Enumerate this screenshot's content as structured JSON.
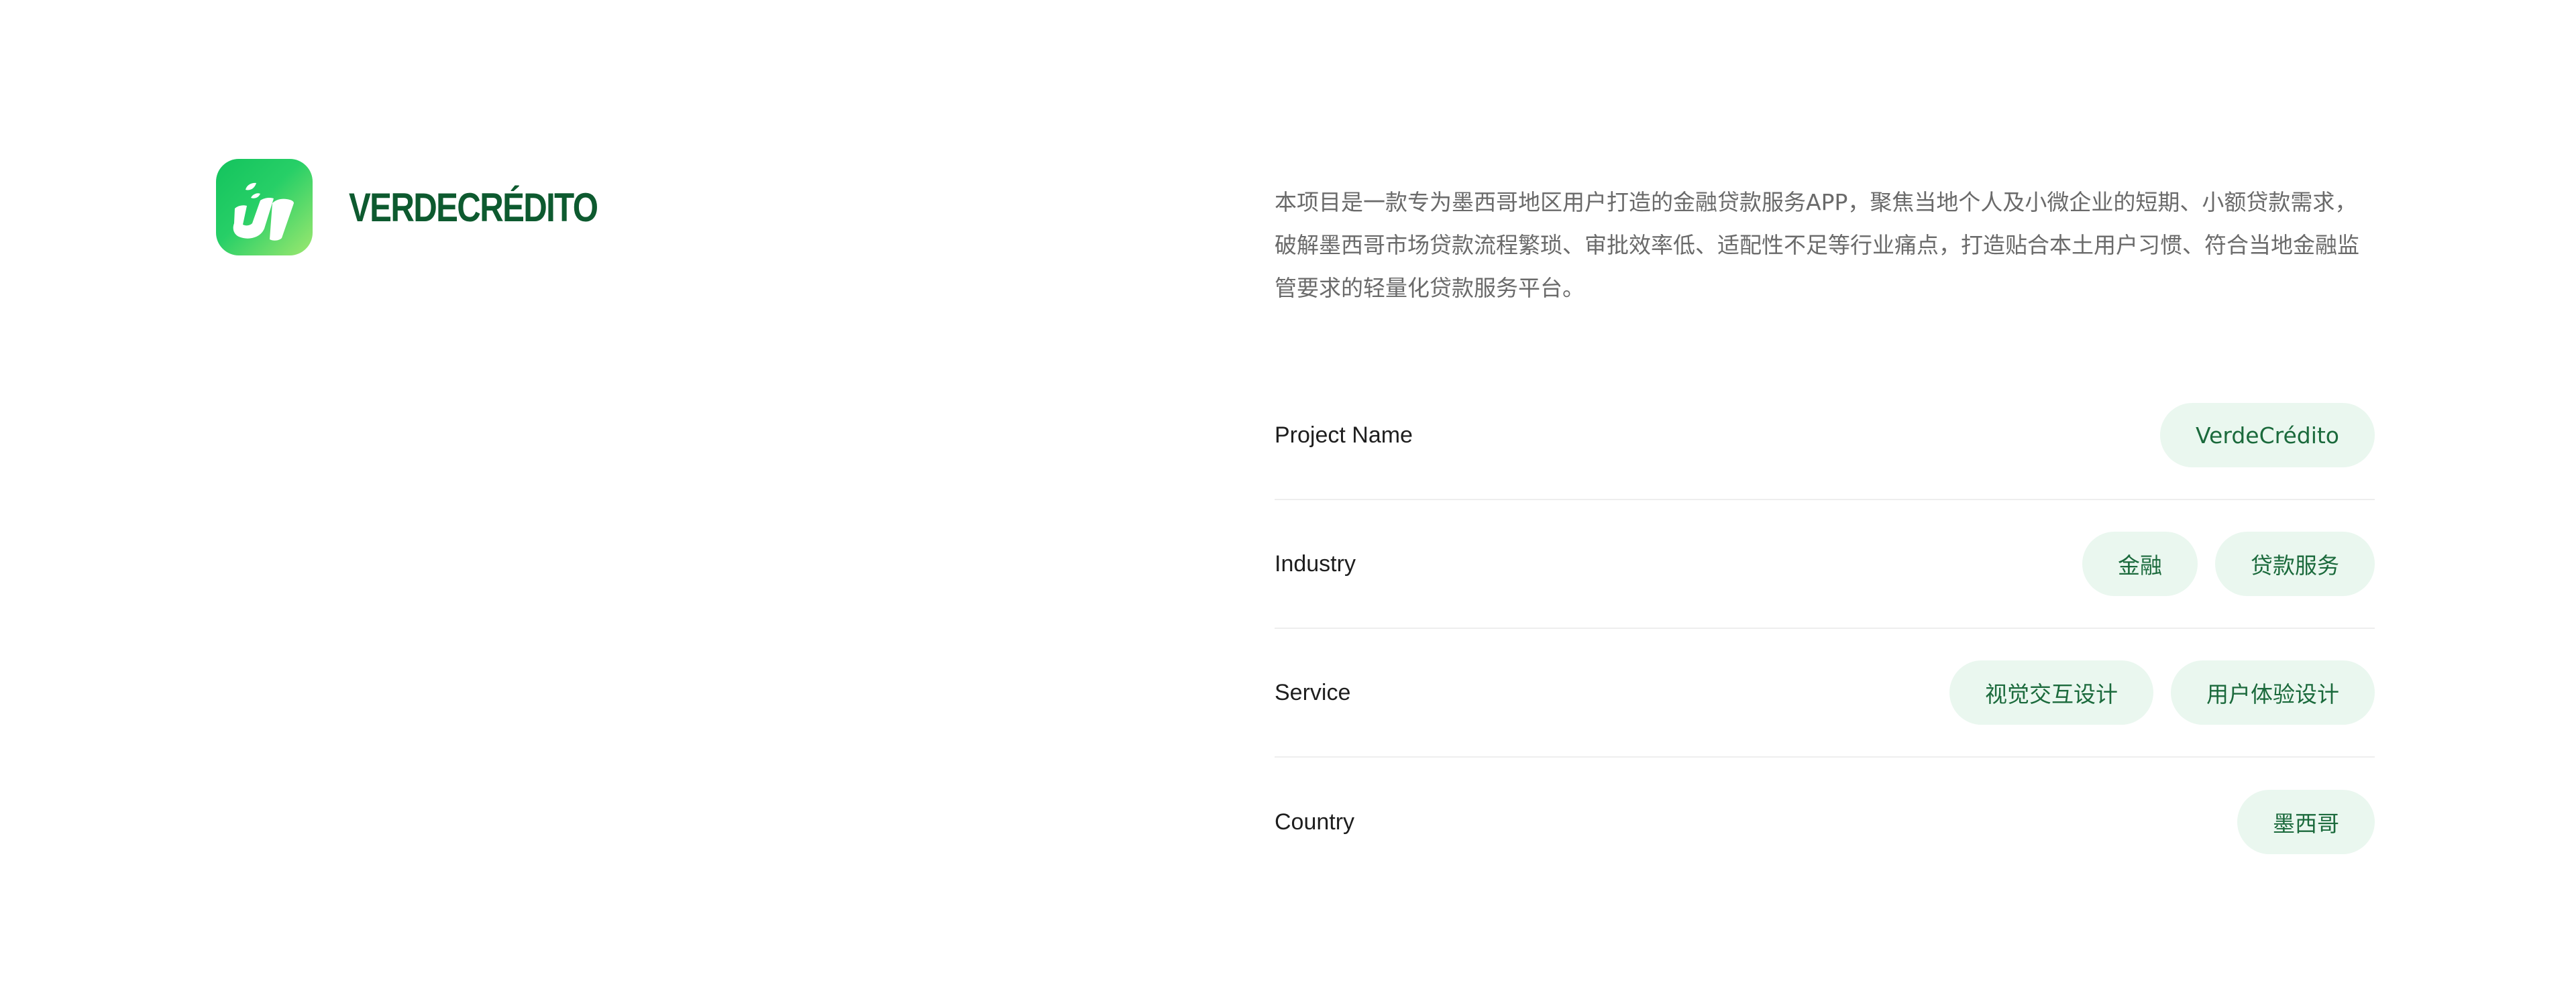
{
  "brand": {
    "name": "VERDECRÉDITO"
  },
  "intro": {
    "text": "本项目是一款专为墨西哥地区用户打造的金融贷款服务APP，聚焦当地个人及小微企业的短期、小额贷款需求，破解墨西哥市场贷款流程繁琐、审批效率低、适配性不足等行业痛点，打造贴合本土用户习惯、符合当地金融监管要求的轻量化贷款服务平台。"
  },
  "rows": [
    {
      "label": "Project Name",
      "tags": [
        "VerdeCrédito"
      ]
    },
    {
      "label": "Industry",
      "tags": [
        "金融",
        "贷款服务"
      ]
    },
    {
      "label": "Service",
      "tags": [
        "视觉交互设计",
        "用户体验设计"
      ]
    },
    {
      "label": "Country",
      "tags": [
        "墨西哥"
      ]
    }
  ],
  "colors": {
    "brand_dark": "#0d5a2f",
    "logo_gradient_start": "#13c35d",
    "logo_gradient_end": "#9ee86f",
    "tag_bg": "#eaf7ef",
    "tag_text": "#1b6a3c"
  }
}
